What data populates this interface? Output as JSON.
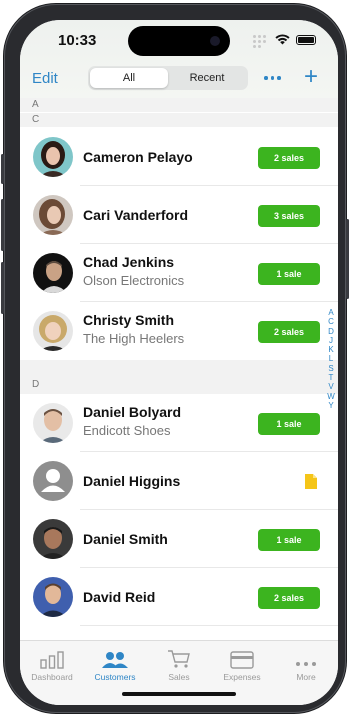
{
  "status_bar": {
    "time": "10:33"
  },
  "navbar": {
    "edit_label": "Edit",
    "segments": [
      {
        "label": "All",
        "active": true
      },
      {
        "label": "Recent",
        "active": false
      }
    ],
    "more_icon": "ellipsis-icon",
    "add_icon": "plus-icon"
  },
  "sections": {
    "a": "A",
    "c": "C",
    "d": "D"
  },
  "contacts": [
    {
      "name": "Cameron Pelayo",
      "company": "",
      "badge": "2 sales"
    },
    {
      "name": "Cari Vanderford",
      "company": "",
      "badge": "3 sales"
    },
    {
      "name": "Chad Jenkins",
      "company": "Olson Electronics",
      "badge": "1 sale"
    },
    {
      "name": "Christy Smith",
      "company": "The High Heelers",
      "badge": "2 sales"
    },
    {
      "name": "Daniel Bolyard",
      "company": "Endicott Shoes",
      "badge": "1 sale"
    },
    {
      "name": "Daniel Higgins",
      "company": "",
      "badge": "",
      "indicator": "document-icon"
    },
    {
      "name": "Daniel Smith",
      "company": "",
      "badge": "1 sale"
    },
    {
      "name": "David Reid",
      "company": "",
      "badge": "2 sales"
    }
  ],
  "index_letters": [
    "A",
    "C",
    "D",
    "J",
    "K",
    "L",
    "S",
    "T",
    "V",
    "W",
    "Y"
  ],
  "tabs": [
    {
      "label": "Dashboard",
      "icon": "bar-chart-icon",
      "active": false
    },
    {
      "label": "Customers",
      "icon": "people-icon",
      "active": true
    },
    {
      "label": "Sales",
      "icon": "cart-icon",
      "active": false
    },
    {
      "label": "Expenses",
      "icon": "credit-card-icon",
      "active": false
    },
    {
      "label": "More",
      "icon": "ellipsis-icon",
      "active": false
    }
  ],
  "colors": {
    "accent": "#2f86c6",
    "badge_green": "#3cb41f",
    "indicator_yellow": "#f5c518"
  }
}
